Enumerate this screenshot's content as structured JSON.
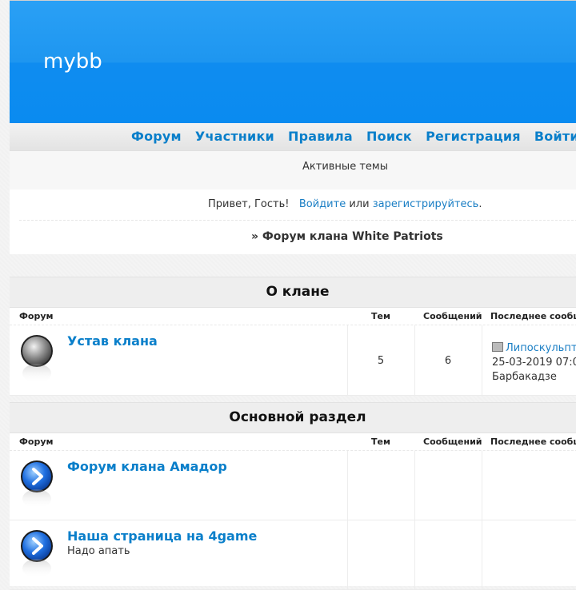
{
  "header": {
    "logo_text": "mybb"
  },
  "nav": {
    "items": [
      "Форум",
      "Участники",
      "Правила",
      "Поиск",
      "Регистрация",
      "Войти"
    ]
  },
  "subnav": {
    "active_topics": "Активные темы"
  },
  "welcome": {
    "greeting": "Привет, Гость!",
    "login_link": "Войдите",
    "or_text": "или",
    "register_link": "зарегистрируйтесь",
    "period": "."
  },
  "breadcrumb": {
    "prefix": "»",
    "title": "Форум клана White Patriots"
  },
  "columns": {
    "forum": "Форум",
    "topics": "Тем",
    "posts": "Сообщений",
    "last_post": "Последнее сообщ"
  },
  "categories": [
    {
      "title": "О клане",
      "forums": [
        {
          "name": "Устав клана",
          "desc": "",
          "icon": "forum-read-icon",
          "topics": "5",
          "posts": "6",
          "last_topic": "Липоскульпт",
          "last_date": "25-03-2019 07:0",
          "last_author": "Барбакадзе"
        }
      ]
    },
    {
      "title": "Основной раздел",
      "forums": [
        {
          "name": "Форум клана Амадор",
          "desc": "",
          "icon": "forum-link-icon"
        },
        {
          "name": "Наша страница на 4game",
          "desc": "Надо апать",
          "icon": "forum-link-icon"
        }
      ]
    }
  ],
  "colors": {
    "link": "#0a7fca",
    "header": "#0a8bf0"
  }
}
